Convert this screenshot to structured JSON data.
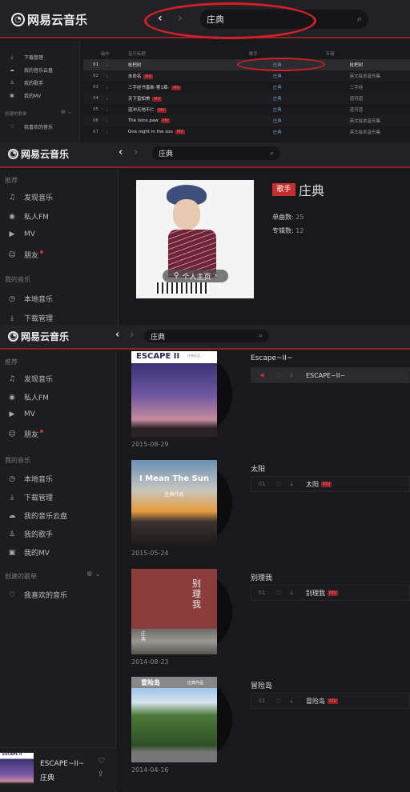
{
  "app": {
    "logo_text": "网易云音乐",
    "search_query": "庄典"
  },
  "section1": {
    "sidebar": [
      {
        "label": "下载管理",
        "icon": "download-icon"
      },
      {
        "label": "我的音乐云盘",
        "icon": "cloud-icon"
      },
      {
        "label": "我的歌手",
        "icon": "singer-icon"
      },
      {
        "label": "我的MV",
        "icon": "mv-icon"
      }
    ],
    "created_header": "创建的歌单",
    "liked": "我喜欢的音乐",
    "columns": [
      "操作",
      "音乐标题",
      "歌手",
      "专辑"
    ],
    "rows": [
      {
        "no": "01",
        "title": "枇杷树",
        "badge": "",
        "artist": "庄典",
        "album": "枇杷树"
      },
      {
        "no": "02",
        "title": "未命名",
        "badge": "MV",
        "artist": "庄典",
        "album": "英文绘本音乐集"
      },
      {
        "no": "03",
        "title": "三字经书香新-第1章-",
        "badge": "MV",
        "artist": "庄典",
        "album": "三字经"
      },
      {
        "no": "04",
        "title": "天下皆知美",
        "badge": "MV",
        "artist": "庄典",
        "album": "道可道"
      },
      {
        "no": "05",
        "title": "道冲天地不仁",
        "badge": "MV",
        "artist": "庄典",
        "album": "道可道"
      },
      {
        "no": "06",
        "title": "The lions paw",
        "badge": "MV",
        "artist": "庄典",
        "album": "英文绘本音乐集"
      },
      {
        "no": "07",
        "title": "One night in the zoo",
        "badge": "MV",
        "artist": "庄典",
        "album": "英文绘本音乐集"
      }
    ]
  },
  "sidebar": {
    "recommend_header": "推荐",
    "recommend": [
      {
        "label": "发现音乐",
        "icon": "music-note-icon"
      },
      {
        "label": "私人FM",
        "icon": "radio-icon"
      },
      {
        "label": "MV",
        "icon": "video-icon"
      },
      {
        "label": "朋友",
        "icon": "friends-icon"
      }
    ],
    "my_music_header": "我的音乐",
    "my_music": [
      {
        "label": "本地音乐",
        "icon": "clock-icon"
      },
      {
        "label": "下载管理",
        "icon": "download-icon"
      },
      {
        "label": "我的音乐云盘",
        "icon": "cloud-icon"
      },
      {
        "label": "我的歌手",
        "icon": "singer-icon"
      },
      {
        "label": "我的MV",
        "icon": "mv-icon"
      }
    ],
    "created_header": "创建的歌单",
    "liked": "我喜欢的音乐"
  },
  "artist": {
    "tag": "歌手",
    "name": "庄典",
    "songs_label": "单曲数:",
    "songs_count": "25",
    "albums_label": "专辑数:",
    "albums_count": "12",
    "homepage_button": "个人主页"
  },
  "albums": [
    {
      "cover_title": "ESCAPE II",
      "cover_sub": "庄典作品",
      "title": "Escape~II~",
      "date": "2015-08-29",
      "track_no": "",
      "track": "ESCAPE~II~",
      "badge": "",
      "playing": true
    },
    {
      "cover_title": "I Mean The Sun",
      "cover_sub": "庄典作品",
      "title": "太阳",
      "date": "2015-05-24",
      "track_no": "01",
      "track": "太阳",
      "badge": "MV",
      "playing": false
    },
    {
      "cover_title": "别理我",
      "cover_sub": "庄典",
      "title": "别理我",
      "date": "2014-08-23",
      "track_no": "01",
      "track": "别理我",
      "badge": "MV",
      "playing": false
    },
    {
      "cover_title": "冒险岛",
      "cover_sub": "庄典作品",
      "title": "冒险岛",
      "date": "2014-04-16",
      "track_no": "01",
      "track": "冒险岛",
      "badge": "MV",
      "playing": false
    }
  ],
  "player": {
    "title": "ESCAPE~II~",
    "artist": "庄典",
    "cover_title": "ESCAPE II"
  },
  "colors": {
    "accent": "#c62f2f",
    "background": "#19191c",
    "header": "#222226",
    "annotation": "#d21f2a"
  }
}
